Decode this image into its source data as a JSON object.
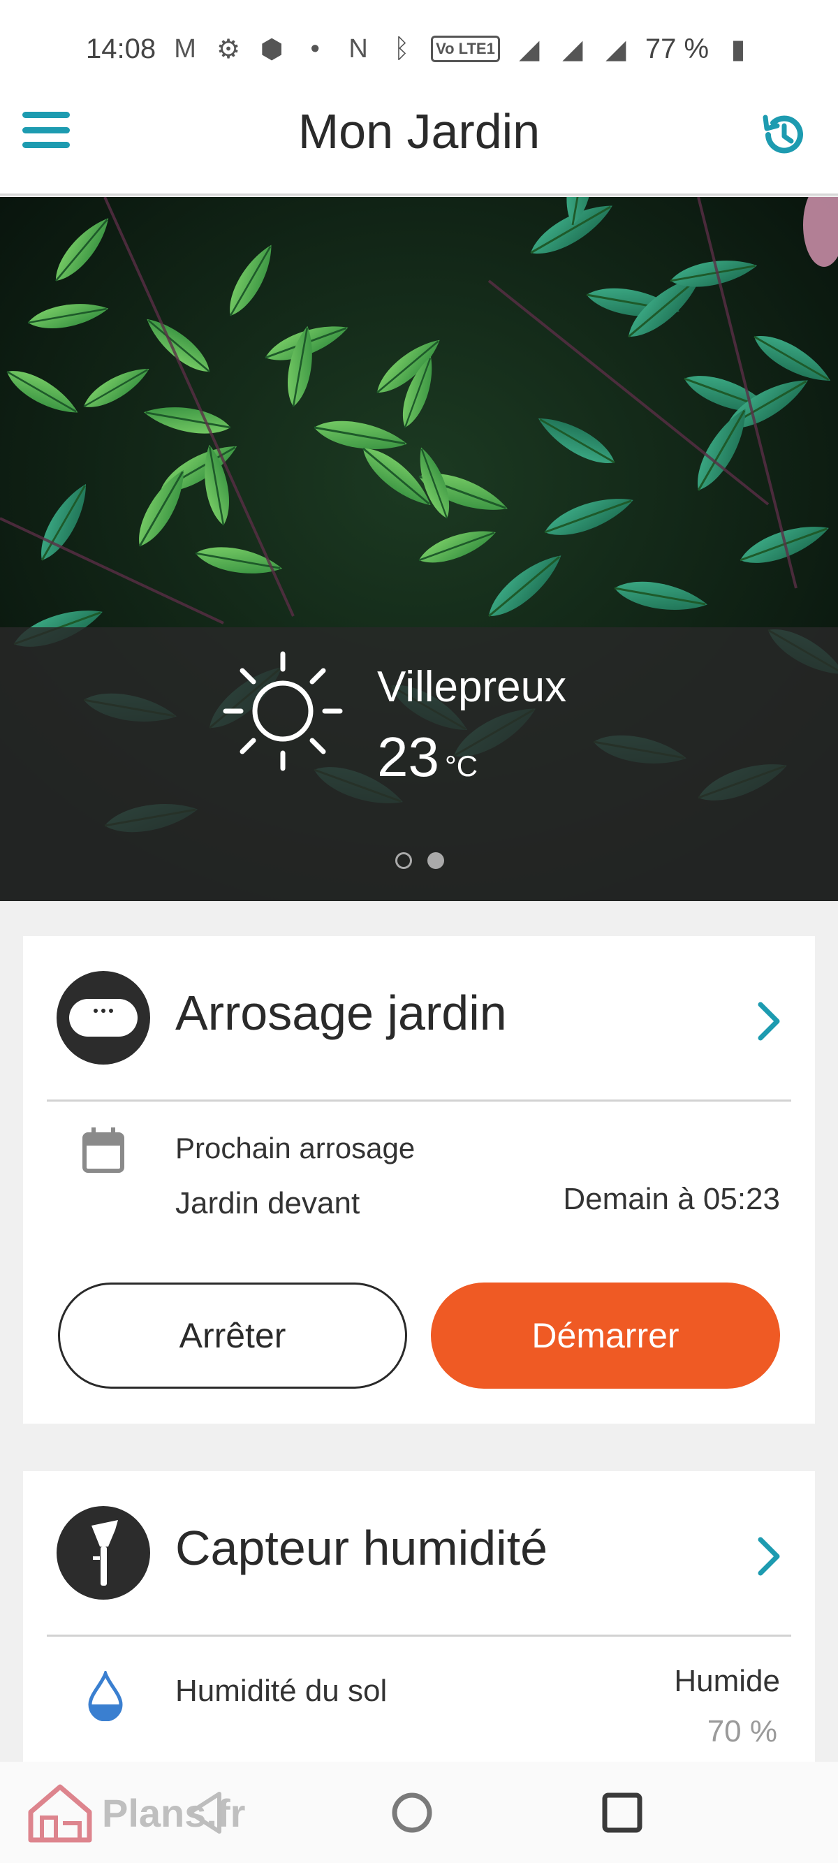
{
  "status_bar": {
    "time": "14:08",
    "lte_badge": "Vo LTE1",
    "battery": "77 %"
  },
  "app_bar": {
    "title": "Mon Jardin",
    "menu_icon": "hamburger-menu-icon",
    "history_icon": "history-clock-icon",
    "accent_color": "#1d9bb0"
  },
  "weather": {
    "city": "Villepreux",
    "temperature": "23",
    "unit": "°C",
    "icon": "sun-icon",
    "carousel_pages": 2,
    "carousel_active": 2
  },
  "watering_card": {
    "title": "Arrosage jardin",
    "icon": "watering-controller-icon",
    "next_label": "Prochain arrosage",
    "zone": "Jardin devant",
    "next_time": "Demain à 05:23",
    "stop_label": "Arrêter",
    "start_label": "Démarrer",
    "start_color": "#ef5a24"
  },
  "sensor_card": {
    "title": "Capteur humidité",
    "icon": "soil-sensor-icon",
    "humidity_label": "Humidité du sol",
    "humidity_state": "Humide",
    "humidity_value": "70 %"
  },
  "watermark": {
    "text": "Plans.fr"
  }
}
